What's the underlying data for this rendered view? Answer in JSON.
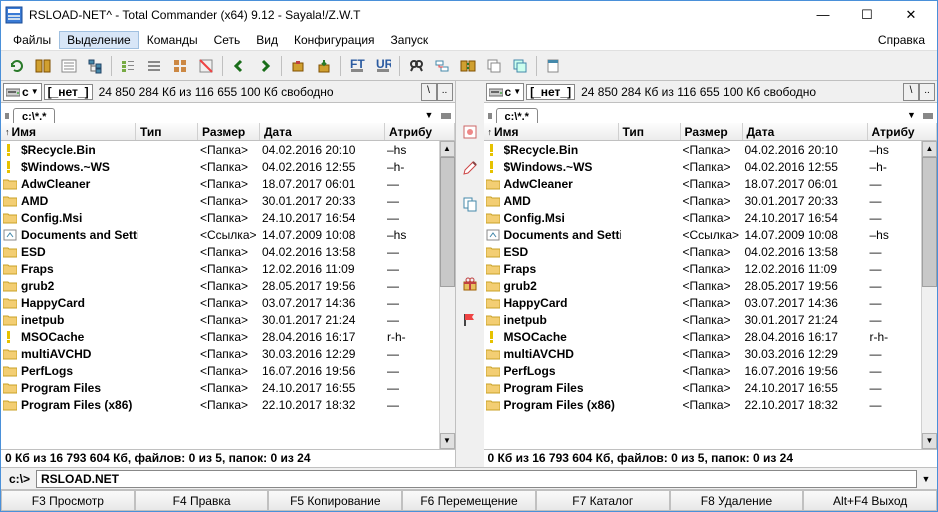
{
  "title": "RSLOAD-NET^ - Total Commander (x64) 9.12 - Sayala!/Z.W.T",
  "menu": {
    "files": "Файлы",
    "select": "Выделение",
    "commands": "Команды",
    "net": "Сеть",
    "view": "Вид",
    "config": "Конфигурация",
    "run": "Запуск",
    "help": "Справка"
  },
  "drive": {
    "letter": "c",
    "label": "[_нет_]",
    "info": "24 850 284 Кб из 116 655 100 Кб свободно"
  },
  "tab": "c:\\*.*",
  "nav": {
    "back": "\\",
    "up": ".."
  },
  "cols": {
    "name": "Имя",
    "ext": "Тип",
    "size": "Размер",
    "date": "Дата",
    "attr": "Атрибу"
  },
  "files": [
    {
      "icon": "warn",
      "name": "$Recycle.Bin",
      "size": "<Папка>",
      "date": "04.02.2016 20:10",
      "attr": "–hs"
    },
    {
      "icon": "warn",
      "name": "$Windows.~WS",
      "size": "<Папка>",
      "date": "04.02.2016 12:55",
      "attr": "–h-"
    },
    {
      "icon": "folder",
      "name": "AdwCleaner",
      "size": "<Папка>",
      "date": "18.07.2017 06:01",
      "attr": "—"
    },
    {
      "icon": "folder",
      "name": "AMD",
      "size": "<Папка>",
      "date": "30.01.2017 20:33",
      "attr": "—"
    },
    {
      "icon": "folder",
      "name": "Config.Msi",
      "size": "<Папка>",
      "date": "24.10.2017 16:54",
      "attr": "—"
    },
    {
      "icon": "link",
      "name": "Documents and Settings",
      "size": "<Ссылка>",
      "date": "14.07.2009 10:08",
      "attr": "–hs"
    },
    {
      "icon": "folder",
      "name": "ESD",
      "size": "<Папка>",
      "date": "04.02.2016 13:58",
      "attr": "—"
    },
    {
      "icon": "folder",
      "name": "Fraps",
      "size": "<Папка>",
      "date": "12.02.2016 11:09",
      "attr": "—"
    },
    {
      "icon": "folder",
      "name": "grub2",
      "size": "<Папка>",
      "date": "28.05.2017 19:56",
      "attr": "—"
    },
    {
      "icon": "folder",
      "name": "HappyCard",
      "size": "<Папка>",
      "date": "03.07.2017 14:36",
      "attr": "—"
    },
    {
      "icon": "folder",
      "name": "inetpub",
      "size": "<Папка>",
      "date": "30.01.2017 21:24",
      "attr": "—"
    },
    {
      "icon": "warn",
      "name": "MSOCache",
      "size": "<Папка>",
      "date": "28.04.2016 16:17",
      "attr": "r-h-"
    },
    {
      "icon": "folder",
      "name": "multiAVCHD",
      "size": "<Папка>",
      "date": "30.03.2016 12:29",
      "attr": "—"
    },
    {
      "icon": "folder",
      "name": "PerfLogs",
      "size": "<Папка>",
      "date": "16.07.2016 19:56",
      "attr": "—"
    },
    {
      "icon": "folder",
      "name": "Program Files",
      "size": "<Папка>",
      "date": "24.10.2017 16:55",
      "attr": "—"
    },
    {
      "icon": "folder",
      "name": "Program Files (x86)",
      "size": "<Папка>",
      "date": "22.10.2017 18:32",
      "attr": "—"
    }
  ],
  "status": "0 Кб из 16 793 604 Кб, файлов: 0 из 5, папок: 0 из 24",
  "cmd": {
    "prompt": "c:\\>",
    "value": "RSLOAD.NET"
  },
  "fnkeys": {
    "f3": "F3 Просмотр",
    "f4": "F4 Правка",
    "f5": "F5 Копирование",
    "f6": "F6 Перемещение",
    "f7": "F7 Каталог",
    "f8": "F8 Удаление",
    "altf4": "Alt+F4 Выход"
  }
}
